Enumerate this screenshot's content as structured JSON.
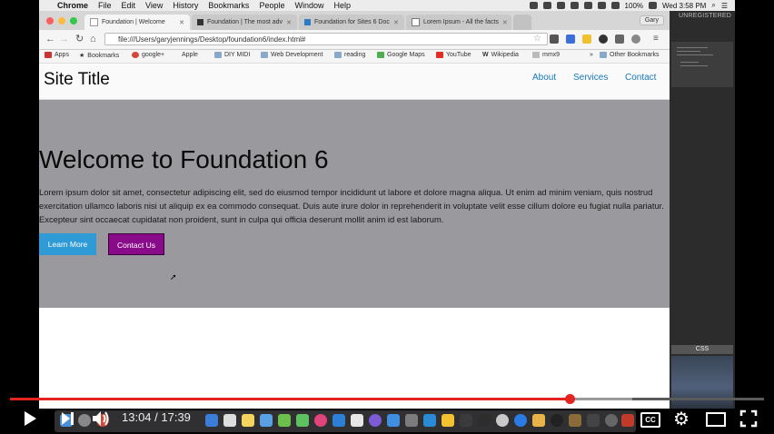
{
  "menubar": {
    "items": [
      "Chrome",
      "File",
      "Edit",
      "View",
      "History",
      "Bookmarks",
      "People",
      "Window",
      "Help"
    ],
    "battery": "100%",
    "clock": "Wed 3:58 PM"
  },
  "browser": {
    "tabs": [
      {
        "title": "Foundation | Welcome"
      },
      {
        "title": "Foundation | The most adv"
      },
      {
        "title": "Foundation for Sites 6 Doc"
      },
      {
        "title": "Lorem Ipsum - All the facts"
      }
    ],
    "profile": "Gary",
    "url": "file:///Users/garyjennings/Desktop/foundation6/index.html#",
    "bookmarks": [
      "Apps",
      "Bookmarks",
      "google+",
      "Apple",
      "DIY MIDI",
      "Web Development",
      "reading",
      "Google Maps",
      "YouTube",
      "Wikipedia",
      "mmx9"
    ],
    "overflow": "»",
    "other_bookmarks": "Other Bookmarks"
  },
  "page": {
    "site_title": "Site Title",
    "nav": [
      "About",
      "Services",
      "Contact"
    ],
    "hero_title": "Welcome to Foundation 6",
    "hero_text": "Lorem ipsum dolor sit amet, consectetur adipiscing elit, sed do eiusmod tempor incididunt ut labore et dolore magna aliqua. Ut enim ad minim veniam, quis nostrud exercitation ullamco laboris nisi ut aliquip ex ea commodo consequat. Duis aute irure dolor in reprehenderit in voluptate velit esse cillum dolore eu fugiat nulla pariatur. Excepteur sint occaecat cupidatat non proident, sunt in culpa qui officia deserunt mollit anim id est laborum.",
    "learn_more": "Learn More",
    "contact_us": "Contact Us"
  },
  "editor": {
    "status": "UNREGISTERED",
    "tab": "CSS"
  },
  "player": {
    "time": "13:04 / 17:39",
    "progress": 0.742,
    "buffered": 0.825,
    "cc": "CC"
  },
  "colors": {
    "accent": "#1779ba",
    "hero_bg": "#9a9a9e",
    "learn_btn": "#2e9bd7",
    "contact_btn": "#8a0b8a",
    "progress": "#e52421"
  }
}
